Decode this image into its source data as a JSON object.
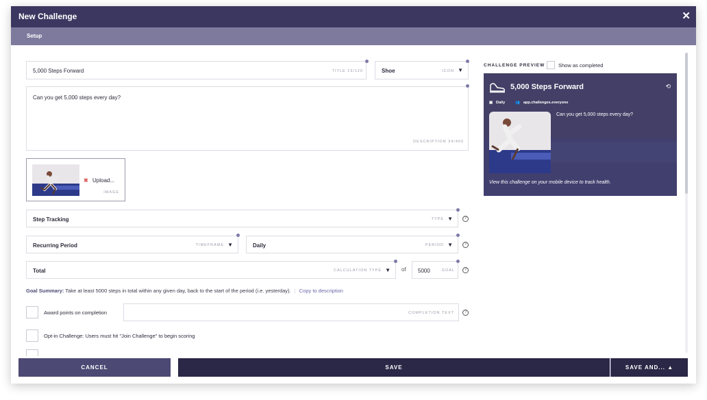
{
  "header": {
    "title": "New Challenge",
    "close_label": "✕"
  },
  "tabs": {
    "setup": "Setup"
  },
  "form": {
    "title_value": "5,000 Steps Forward",
    "title_tag": "TITLE 19/120",
    "icon_value": "Shoe",
    "icon_tag": "ICON",
    "description_value": "Can you get 5,000 steps every day?",
    "description_tag": "DESCRIPTION 34/400",
    "upload_label": "Upload...",
    "image_tag": "IMAGE",
    "type_value": "Step Tracking",
    "type_tag": "TYPE",
    "timeframe_value": "Recurring Period",
    "timeframe_tag": "TIMEFRAME",
    "period_value": "Daily",
    "period_tag": "PERIOD",
    "calc_value": "Total",
    "calc_tag": "CALCULATION TYPE",
    "of_label": "of",
    "goal_value": "5000",
    "goal_tag": "GOAL",
    "goal_summary_label": "Goal Summary:",
    "goal_summary_text": "Take at least 5000 steps in total within any given day, back to the start of the period (i.e. yesterday).",
    "copy_link": "Copy to description",
    "award_label": "Award points on completion",
    "completion_tag": "COMPLETION TEXT",
    "optin_label": "Opt-in Challenge: Users must hit \"Join Challenge\" to begin scoring",
    "help_glyph": "?"
  },
  "preview": {
    "heading": "CHALLENGE PREVIEW",
    "show_completed": "Show as completed",
    "title": "5,000 Steps Forward",
    "period": "Daily",
    "audience": "app.challenges.everyone",
    "description": "Can you get 5,000 steps every day?",
    "footer": "View this challenge on your mobile device to track health."
  },
  "footer": {
    "cancel": "CANCEL",
    "save": "SAVE",
    "save_and": "SAVE AND... ▲"
  },
  "colors": {
    "header": "#3b3760",
    "subbar": "#7d7a9e",
    "cancel": "#4c4974",
    "save": "#2b2746",
    "link": "#6a67a8"
  },
  "icons": [
    "close-icon",
    "shoe-icon",
    "refresh-icon",
    "calendar-icon",
    "people-icon",
    "caret-down-icon",
    "help-icon",
    "remove-icon"
  ]
}
